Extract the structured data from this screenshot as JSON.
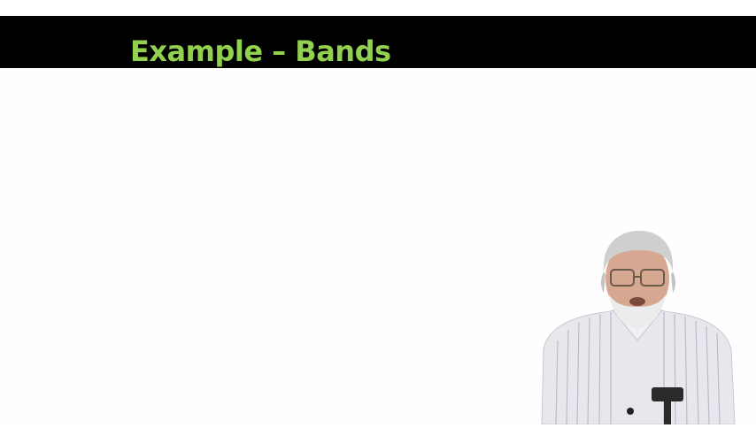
{
  "slide": {
    "title": "Example – Bands",
    "colors": {
      "title_bar": "#000000",
      "title_text": "#92d050",
      "background": "#ffffff"
    }
  }
}
